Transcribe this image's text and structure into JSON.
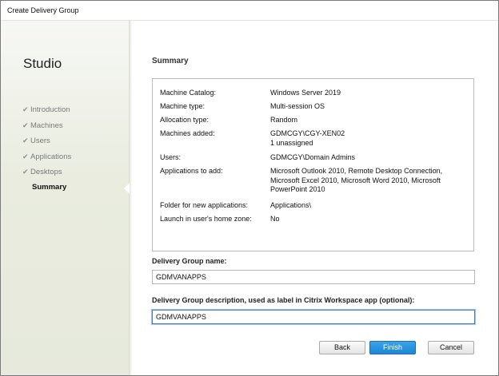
{
  "window": {
    "title": "Create Delivery Group"
  },
  "sidebar": {
    "brand": "Studio",
    "steps": [
      {
        "label": "Introduction",
        "completed": true
      },
      {
        "label": "Machines",
        "completed": true
      },
      {
        "label": "Users",
        "completed": true
      },
      {
        "label": "Applications",
        "completed": true
      },
      {
        "label": "Desktops",
        "completed": true
      },
      {
        "label": "Summary",
        "completed": false,
        "active": true
      }
    ],
    "check_glyph": "✔"
  },
  "main": {
    "section_title": "Summary",
    "summary": [
      {
        "label": "Machine Catalog:",
        "value": "Windows Server 2019"
      },
      {
        "label": "Machine type:",
        "value": "Multi-session OS"
      },
      {
        "label": "Allocation type:",
        "value": "Random"
      },
      {
        "label": "Machines added:",
        "value": "GDMCGY\\CGY-XEN02",
        "value2": "1 unassigned"
      },
      {
        "label": "Users:",
        "value": "GDMCGY\\Domain Admins"
      },
      {
        "label": "Applications to add:",
        "value": "Microsoft Outlook 2010, Remote Desktop Connection, Microsoft Excel 2010, Microsoft Word 2010, Microsoft PowerPoint 2010"
      },
      {
        "label": "Folder for new applications:",
        "value": "Applications\\"
      },
      {
        "label": "Launch in user's home zone:",
        "value": "No"
      }
    ],
    "name_field": {
      "label": "Delivery Group name:",
      "value": "GDMVANAPPS"
    },
    "description_field": {
      "label": "Delivery Group description, used as label in Citrix Workspace app (optional):",
      "value": "GDMVANAPPS"
    }
  },
  "buttons": {
    "back": "Back",
    "finish": "Finish",
    "cancel": "Cancel"
  },
  "colors": {
    "accent": "#1e86d3",
    "sidebar": "#e9ecdf",
    "focus_border": "#4a7fcf"
  }
}
